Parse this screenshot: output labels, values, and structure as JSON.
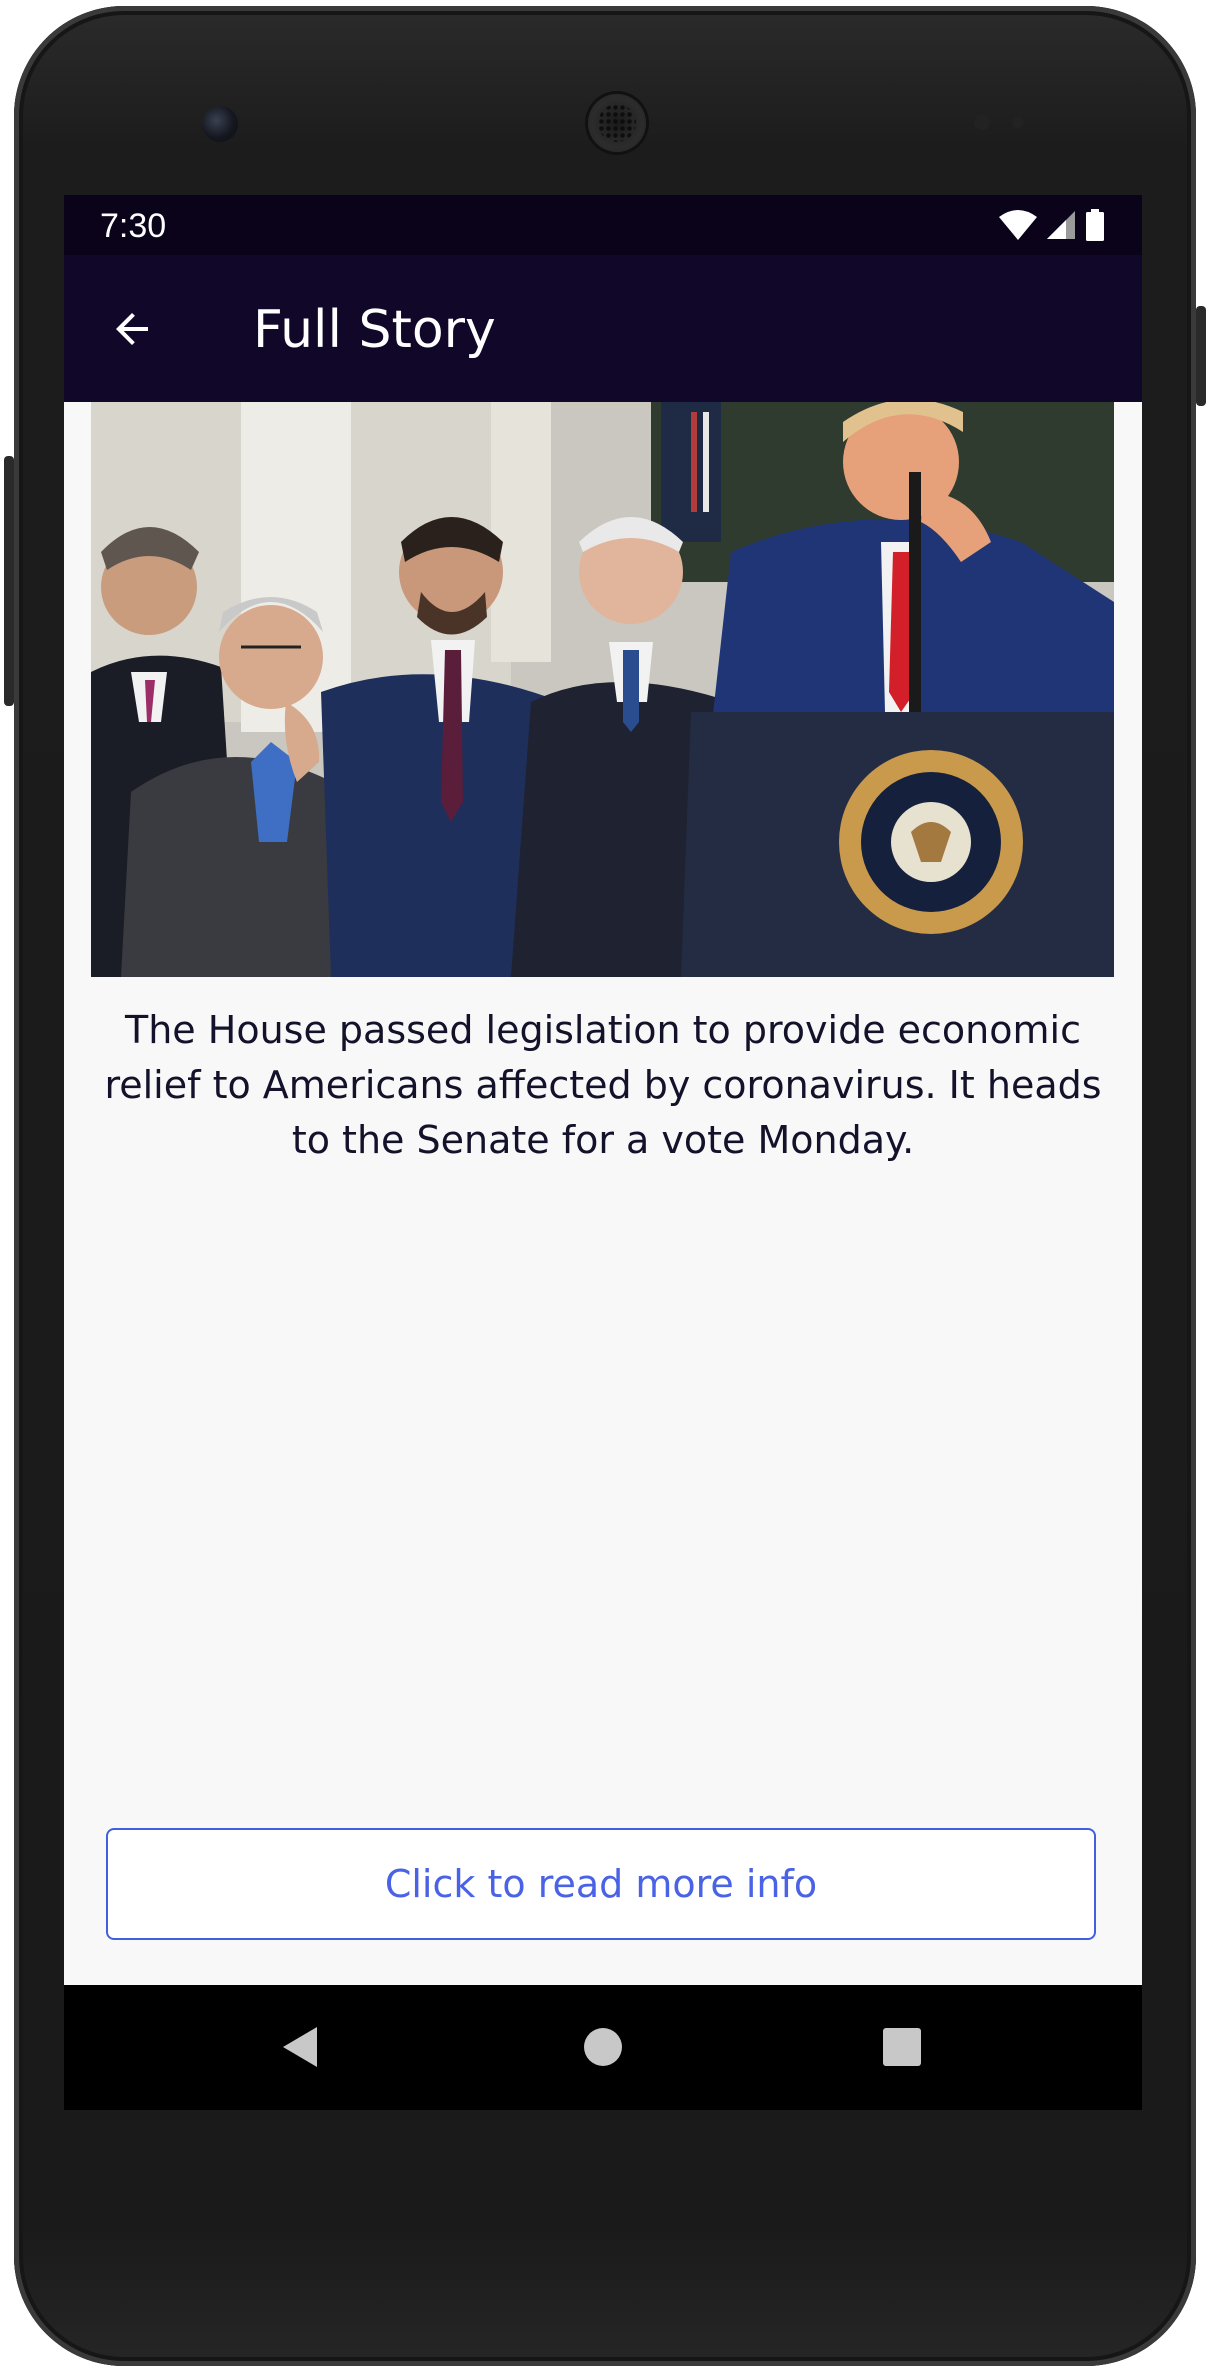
{
  "status_bar": {
    "time": "7:30",
    "icons": [
      "wifi-icon",
      "cell-signal-icon",
      "battery-icon"
    ]
  },
  "app_bar": {
    "back_icon": "arrow-left-icon",
    "title": "Full Story"
  },
  "story": {
    "image_description": "photo",
    "text": "The House passed legislation to provide economic relief to Americans affected by coronavirus. It heads to the Senate for a vote Monday."
  },
  "actions": {
    "read_more_label": "Click to read more info"
  },
  "nav_bar": {
    "back_icon": "triangle-back-icon",
    "home_icon": "circle-home-icon",
    "recents_icon": "square-recents-icon"
  },
  "colors": {
    "status_bar": "#0a0319",
    "app_bar": "#110729",
    "screen_bg": "#f8f8f8",
    "accent": "#4a63e6",
    "text": "#14122a"
  }
}
